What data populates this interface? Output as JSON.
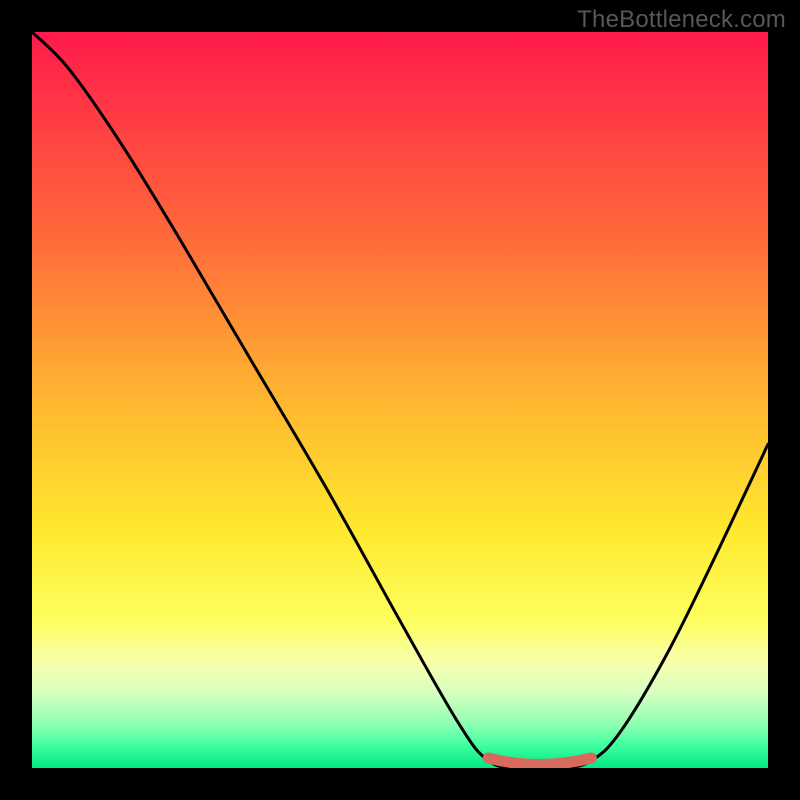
{
  "watermark": "TheBottleneck.com",
  "chart_data": {
    "type": "line",
    "title": "",
    "xlabel": "",
    "ylabel": "",
    "x_range": [
      0,
      100
    ],
    "y_range": [
      0,
      100
    ],
    "curve": [
      {
        "x": 0,
        "y": 100
      },
      {
        "x": 5,
        "y": 95
      },
      {
        "x": 12,
        "y": 85
      },
      {
        "x": 20,
        "y": 72
      },
      {
        "x": 30,
        "y": 55
      },
      {
        "x": 40,
        "y": 38
      },
      {
        "x": 50,
        "y": 20
      },
      {
        "x": 58,
        "y": 6
      },
      {
        "x": 62,
        "y": 1
      },
      {
        "x": 66,
        "y": 0
      },
      {
        "x": 72,
        "y": 0
      },
      {
        "x": 76,
        "y": 1
      },
      {
        "x": 80,
        "y": 5
      },
      {
        "x": 86,
        "y": 15
      },
      {
        "x": 92,
        "y": 27
      },
      {
        "x": 100,
        "y": 44
      }
    ],
    "highlight_segment": {
      "x_start": 62,
      "x_end": 76,
      "y": 0
    },
    "gradient_stops": [
      {
        "pct": 0,
        "color": "#ff1a4b"
      },
      {
        "pct": 28,
        "color": "#ff6a3a"
      },
      {
        "pct": 50,
        "color": "#ffb631"
      },
      {
        "pct": 68,
        "color": "#ffe92e"
      },
      {
        "pct": 80,
        "color": "#feff60"
      },
      {
        "pct": 86,
        "color": "#f6ffb0"
      },
      {
        "pct": 90,
        "color": "#d4ffc0"
      },
      {
        "pct": 94,
        "color": "#8fffb3"
      },
      {
        "pct": 97,
        "color": "#3effa0"
      },
      {
        "pct": 100,
        "color": "#00e884"
      }
    ]
  }
}
